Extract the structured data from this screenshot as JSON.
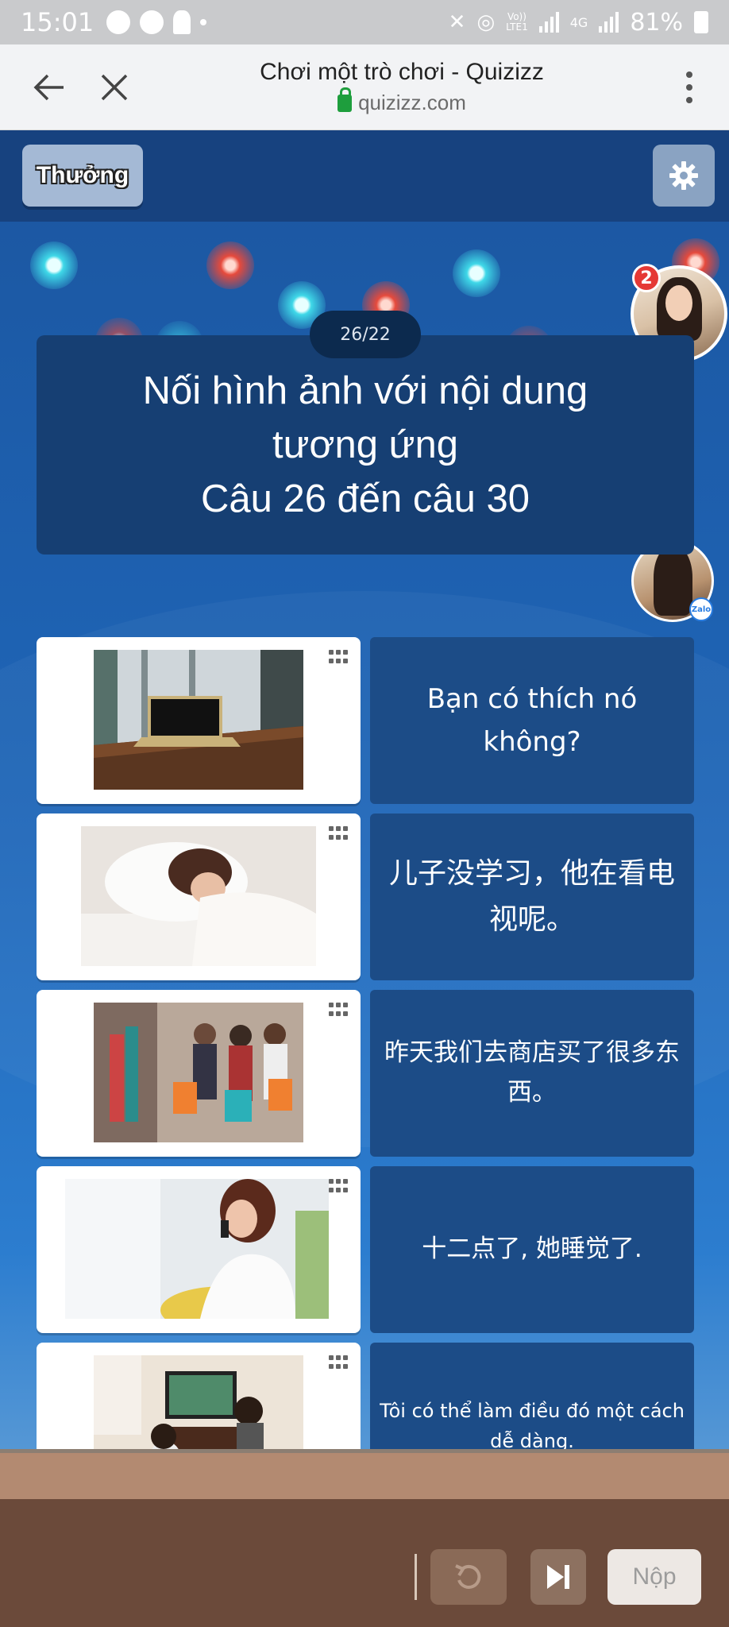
{
  "status_bar": {
    "time": "15:01",
    "network_label": "Vo))\nLTE1",
    "network_type": "4G",
    "battery": "81%"
  },
  "browser": {
    "title": "Chơi một trò chơi - Quizizz",
    "url": "quizizz.com",
    "icons": [
      "back-arrow-icon",
      "close-icon",
      "lock-icon",
      "kebab-menu-icon"
    ]
  },
  "game": {
    "mode_button": "Thưởng",
    "counter": "26/22",
    "avatar_badge": "2",
    "zalo_badge": "Zalo",
    "question_lines": [
      "Nối hình ảnh với nội dung",
      "tương ứng",
      "Câu 26 đến câu 30"
    ],
    "matches": [
      {
        "image": "laptop-on-table",
        "text": "Bạn có thích nó không?",
        "size": "34px"
      },
      {
        "image": "woman-sleeping",
        "text": "儿子没学习，他在看电视呢。",
        "size": "36px"
      },
      {
        "image": "women-shopping",
        "text": "昨天我们去商店买了很多东西。",
        "size": "31px"
      },
      {
        "image": "woman-on-phone",
        "text": "十二点了, 她睡觉了.",
        "size": "31px"
      },
      {
        "image": "kids-watching-tv",
        "text": "Tôi có thể làm điều đó một cách dễ dàng.",
        "size": "24px"
      }
    ],
    "submit_button": "Nộp"
  },
  "colors": {
    "background": "#1f5fa8",
    "card_text_bg": "#1c4c87",
    "question_bg": "#163f73"
  }
}
